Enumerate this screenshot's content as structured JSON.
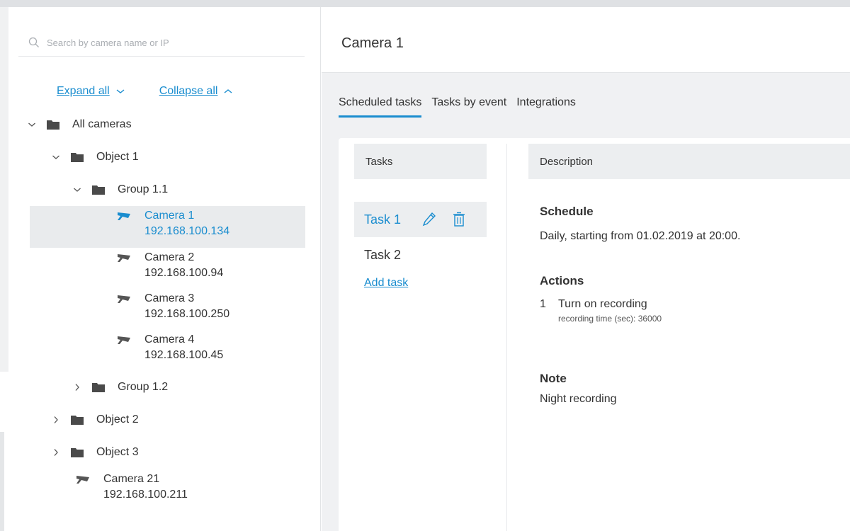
{
  "search": {
    "placeholder": "Search by camera name or IP"
  },
  "tree_controls": {
    "expand_all": "Expand all",
    "collapse_all": "Collapse all"
  },
  "tree": {
    "all_cameras": "All cameras",
    "object1": "Object 1",
    "group11": "Group 1.1",
    "cameras_g11": [
      {
        "name": "Camera 1",
        "ip": "192.168.100.134"
      },
      {
        "name": "Camera 2",
        "ip": "192.168.100.94"
      },
      {
        "name": "Camera 3",
        "ip": "192.168.100.250"
      },
      {
        "name": "Camera 4",
        "ip": "192.168.100.45"
      }
    ],
    "group12": "Group 1.2",
    "object2": "Object 2",
    "object3": "Object 3",
    "camera21": {
      "name": "Camera 21",
      "ip": "192.168.100.211"
    }
  },
  "main": {
    "title": "Camera 1",
    "tabs": [
      "Scheduled tasks",
      "Tasks by event",
      "Integrations"
    ],
    "tasks_header": "Tasks",
    "description_header": "Description",
    "tasks": [
      "Task 1",
      "Task 2"
    ],
    "add_task": "Add task",
    "schedule": {
      "title": "Schedule",
      "text": "Daily, starting from 01.02.2019 at 20:00."
    },
    "actions": {
      "title": "Actions",
      "items": [
        {
          "num": "1",
          "text": "Turn on recording",
          "detail": "recording time (sec): 36000"
        }
      ]
    },
    "note": {
      "title": "Note",
      "text": "Night recording"
    }
  },
  "colors": {
    "accent": "#1a8dcf",
    "selected_bg": "#e9ebed",
    "main_bg": "#f0f1f3"
  },
  "icons": [
    "search-icon",
    "chevron-down-icon",
    "chevron-up-icon",
    "folder-icon",
    "camera-icon",
    "pencil-icon",
    "trash-icon"
  ]
}
